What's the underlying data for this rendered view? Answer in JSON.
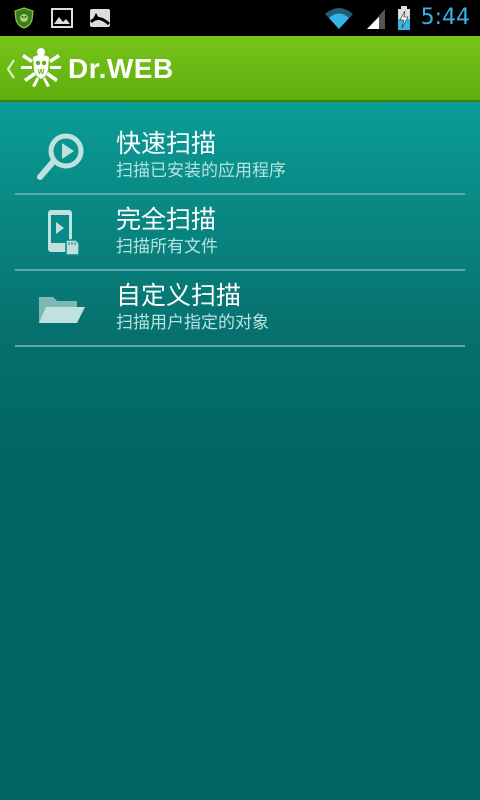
{
  "status_bar": {
    "time": "5:44",
    "icons": [
      "drweb-shield-icon",
      "image-icon",
      "image-broken-icon",
      "wifi-icon",
      "signal-icon",
      "battery-charging-icon"
    ]
  },
  "action_bar": {
    "title": "Dr.WEB",
    "icon": "drweb-spider-logo",
    "up_icon": "chevron-left-icon"
  },
  "scan_options": [
    {
      "title": "快速扫描",
      "subtitle": "扫描已安装的应用程序",
      "icon": "magnifier-play-icon"
    },
    {
      "title": "完全扫描",
      "subtitle": "扫描所有文件",
      "icon": "phone-sdcard-icon"
    },
    {
      "title": "自定义扫描",
      "subtitle": "扫描用户指定的对象",
      "icon": "folder-open-icon"
    }
  ],
  "colors": {
    "accent_status": "#35b5e5",
    "action_bar": "#6cb914",
    "background": "#006562",
    "divider": "#5ea9a6"
  }
}
